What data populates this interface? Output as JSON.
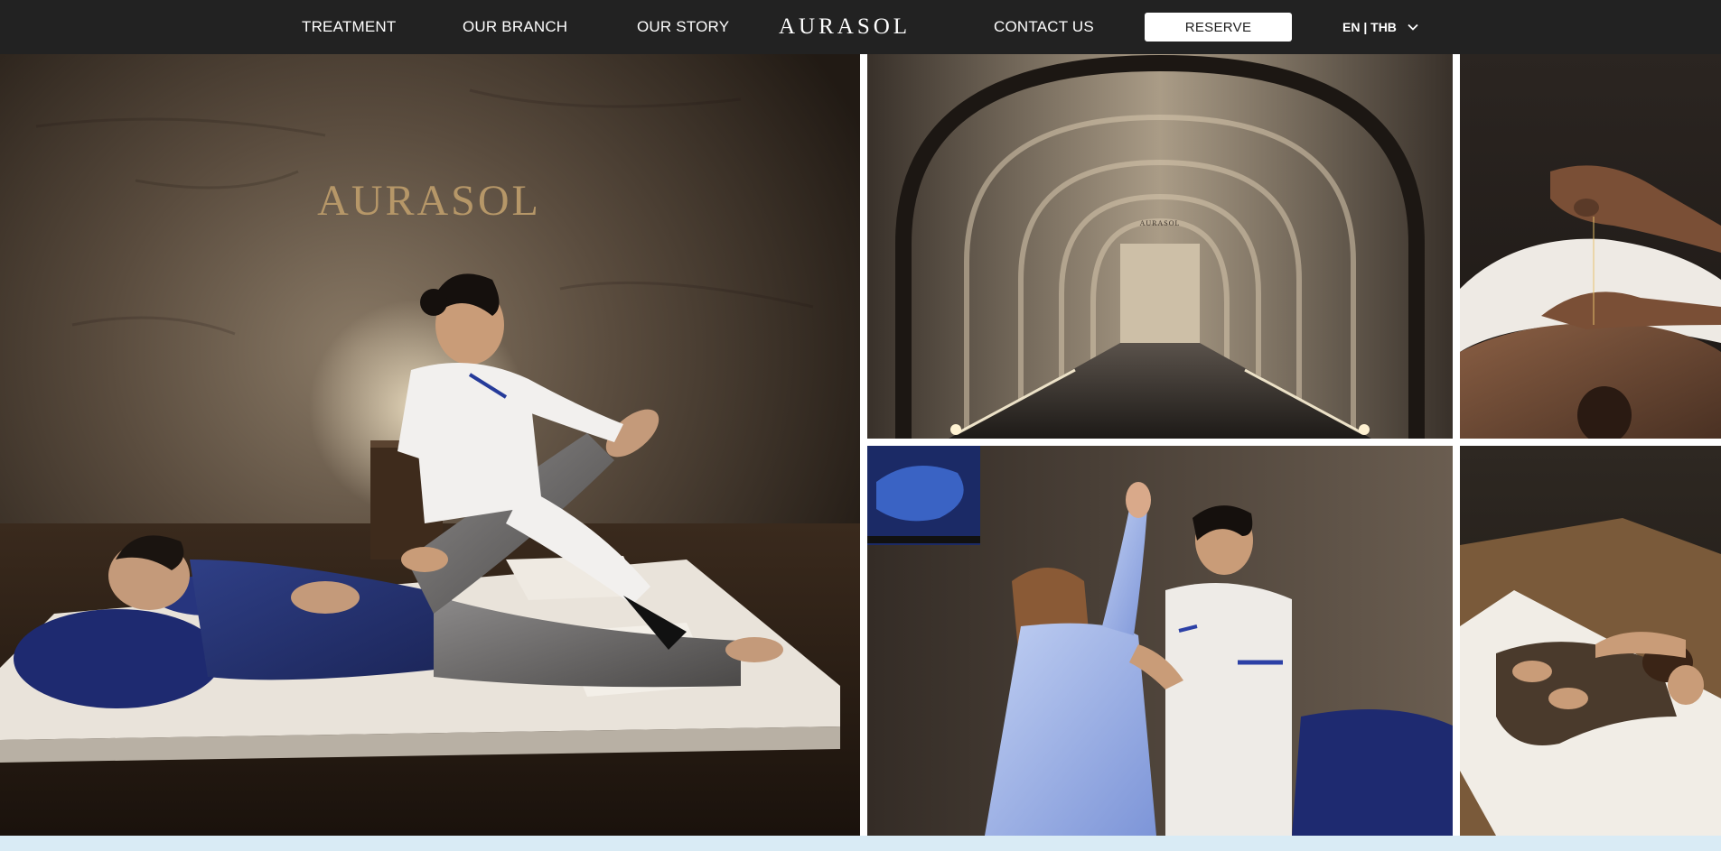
{
  "nav": {
    "links": [
      "TREATMENT",
      "OUR BRANCH",
      "OUR STORY",
      "CONTACT US"
    ],
    "logo": "AURASOL",
    "reserve_label": "RESERVE",
    "lang_label": "EN | THB"
  },
  "gallery": {
    "main_photo": {
      "wall_sign": "AURASOL"
    },
    "corridor_photo": {
      "wall_sign": "AURASOL"
    }
  },
  "colors": {
    "nav_bg": "#222222",
    "nav_text": "#ffffff",
    "reserve_bg": "#ffffff",
    "footer_strip": "#d9ebf5"
  }
}
